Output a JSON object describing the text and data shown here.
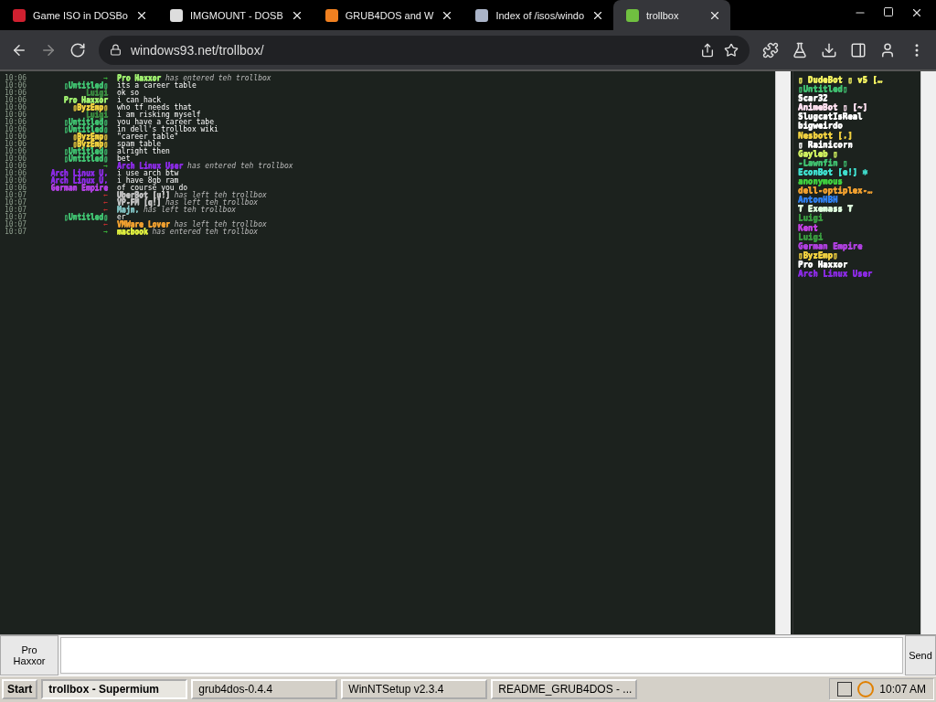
{
  "tabs": [
    {
      "title": "Game ISO in DOSBo",
      "selected": false,
      "color": "#d02030"
    },
    {
      "title": "IMGMOUNT - DOSB",
      "selected": false,
      "color": "#dddddd"
    },
    {
      "title": "GRUB4DOS and W",
      "selected": false,
      "color": "#f08020"
    },
    {
      "title": "Index of /isos/windo",
      "selected": false,
      "color": "#aab4c8"
    },
    {
      "title": "trollbox",
      "selected": true,
      "color": "#70c040"
    }
  ],
  "address": "windows93.net/trollbox/",
  "messages": [
    {
      "time": "10:06",
      "kind": "join",
      "name": "Pro Haxxor",
      "color": "#a0f070",
      "text": "has entered teh trollbox"
    },
    {
      "time": "10:06",
      "kind": "message",
      "name": "▯Untitled▯",
      "color": "#40c070",
      "text": "its a career table"
    },
    {
      "time": "10:06",
      "kind": "message",
      "name": "Luigi",
      "color": "#3a8a40",
      "text": "ok so"
    },
    {
      "time": "10:06",
      "kind": "message",
      "name": "Pro Haxxor",
      "color": "#a0f070",
      "text": "i can hack"
    },
    {
      "time": "10:06",
      "kind": "message",
      "name": "▯ByzEmp▯",
      "color": "#f0d040",
      "text": "who tf needs that"
    },
    {
      "time": "10:06",
      "kind": "message",
      "name": "Luigi",
      "color": "#3a8a40",
      "text": "i am risking myself"
    },
    {
      "time": "10:06",
      "kind": "message",
      "name": "▯Untitled▯",
      "color": "#40c070",
      "text": "you have a career tabe"
    },
    {
      "time": "10:06",
      "kind": "message",
      "name": "▯Untitled▯",
      "color": "#40c070",
      "text": "in dell's trollbox wiki"
    },
    {
      "time": "10:06",
      "kind": "message",
      "name": "▯ByzEmp▯",
      "color": "#f0d040",
      "text": "\"career table\""
    },
    {
      "time": "10:06",
      "kind": "message",
      "name": "▯ByzEmp▯",
      "color": "#f0d040",
      "text": "spam table"
    },
    {
      "time": "10:06",
      "kind": "message",
      "name": "▯Untitled▯",
      "color": "#40c070",
      "text": "alright then"
    },
    {
      "time": "10:06",
      "kind": "message",
      "name": "▯Untitled▯",
      "color": "#40c070",
      "text": "bet"
    },
    {
      "time": "10:06",
      "kind": "join",
      "name": "Arch Linux User",
      "color": "#8a2be2",
      "text": "has entered teh trollbox"
    },
    {
      "time": "10:06",
      "kind": "message",
      "name": "Arch Linux U.",
      "color": "#8a2be2",
      "text": "i use arch btw"
    },
    {
      "time": "10:06",
      "kind": "message",
      "name": "Arch Linux U.",
      "color": "#8a2be2",
      "text": "i have 8gb ram"
    },
    {
      "time": "10:06",
      "kind": "message",
      "name": "German Empire",
      "color": "#b040e0",
      "text": "of course you do"
    },
    {
      "time": "10:07",
      "kind": "leave",
      "name": "UberBot [u!]",
      "color": "#c0c0c0",
      "text": "has left teh trollbox"
    },
    {
      "time": "10:07",
      "kind": "leave",
      "name": "VP-FM [q!]",
      "color": "#c0c0c0",
      "text": "has left teh trollbox"
    },
    {
      "time": "10:07",
      "kind": "leave",
      "name": "Majn.",
      "color": "#80c0c0",
      "text": "has left teh trollbox"
    },
    {
      "time": "10:07",
      "kind": "message",
      "name": "▯Untitled▯",
      "color": "#40c070",
      "text": "er"
    },
    {
      "time": "10:07",
      "kind": "leave",
      "name": "VMWare Lover",
      "color": "#f0a030",
      "text": "has left teh trollbox"
    },
    {
      "time": "10:07",
      "kind": "join",
      "name": "macbook",
      "color": "#e0f040",
      "text": "has entered teh trollbox"
    }
  ],
  "users": [
    {
      "name": "▯ DudeBot ▯ v5 […",
      "color": "#f0f060"
    },
    {
      "name": "▯Untitled▯",
      "color": "#40c070"
    },
    {
      "name": "Scar32",
      "color": "#ffffff"
    },
    {
      "name": "AnimeBot ▯ [~]",
      "color": "#ffe0f0"
    },
    {
      "name": "SlugcatIsReal",
      "color": "#ffffff"
    },
    {
      "name": "bigweirdo",
      "color": "#ffffff"
    },
    {
      "name": "Nesbott [.]",
      "color": "#f0d040"
    },
    {
      "name": "▯ Rainicorn",
      "color": "#ffffff"
    },
    {
      "name": "Gayleb ▯",
      "color": "#d0f060"
    },
    {
      "name": "-Lawnfin ▯",
      "color": "#40c070"
    },
    {
      "name": "EconBot [e!] ❄",
      "color": "#40e0d0"
    },
    {
      "name": "anonymous",
      "color": "#40d040"
    },
    {
      "name": "dell-optiplex-…",
      "color": "#f0a030"
    },
    {
      "name": "AntonHBH",
      "color": "#3080f0"
    },
    {
      "name": "₮ Exemass ₮",
      "color": "#e0ffe0"
    },
    {
      "name": "Luigi",
      "color": "#3a9a40"
    },
    {
      "name": "Kent",
      "color": "#c040e0"
    },
    {
      "name": "Luigi",
      "color": "#3a9a40"
    },
    {
      "name": "German Empire",
      "color": "#b040e0"
    },
    {
      "name": "▯ByzEmp▯",
      "color": "#f0d040"
    },
    {
      "name": "Pro Haxxor",
      "color": "#ffffff"
    },
    {
      "name": "Arch Linux User",
      "color": "#8a2be2"
    }
  ],
  "arrows": {
    "join": "→",
    "leave": "←"
  },
  "input": {
    "nickname": "Pro Haxxor",
    "send": "Send"
  },
  "taskbar": {
    "start": "Start",
    "items": [
      {
        "title": "trollbox - Supermium",
        "selected": true
      },
      {
        "title": "grub4dos-0.4.4",
        "selected": false
      },
      {
        "title": "WinNTSetup v2.3.4",
        "selected": false
      },
      {
        "title": "README_GRUB4DOS - ...",
        "selected": false
      }
    ],
    "clock": "10:07 AM"
  }
}
